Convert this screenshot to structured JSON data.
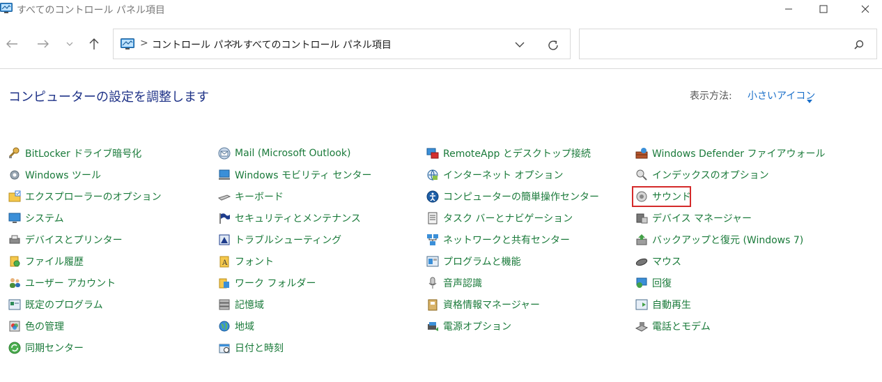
{
  "window": {
    "title": "すべてのコントロール パネル項目"
  },
  "address": {
    "crumbs": [
      "コントロール パネル",
      "すべてのコントロール パネル項目"
    ],
    "separator": ">"
  },
  "search": {
    "placeholder": ""
  },
  "header": {
    "title": "コンピューターの設定を調整します",
    "view_label": "表示方法:",
    "view_value": "小さいアイコン"
  },
  "items": [
    {
      "label": "BitLocker ドライブ暗号化",
      "icon": "bitlocker-icon"
    },
    {
      "label": "Windows ツール",
      "icon": "windows-tools-icon"
    },
    {
      "label": "エクスプローラーのオプション",
      "icon": "folder-options-icon"
    },
    {
      "label": "システム",
      "icon": "system-icon"
    },
    {
      "label": "デバイスとプリンター",
      "icon": "printer-icon"
    },
    {
      "label": "ファイル履歴",
      "icon": "file-history-icon"
    },
    {
      "label": "ユーザー アカウント",
      "icon": "user-accounts-icon"
    },
    {
      "label": "既定のプログラム",
      "icon": "default-programs-icon"
    },
    {
      "label": "色の管理",
      "icon": "color-management-icon"
    },
    {
      "label": "同期センター",
      "icon": "sync-center-icon"
    },
    {
      "label": "Mail (Microsoft Outlook)",
      "icon": "mail-icon"
    },
    {
      "label": "Windows モビリティ センター",
      "icon": "mobility-center-icon"
    },
    {
      "label": "キーボード",
      "icon": "keyboard-icon"
    },
    {
      "label": "セキュリティとメンテナンス",
      "icon": "security-flag-icon"
    },
    {
      "label": "トラブルシューティング",
      "icon": "troubleshooting-icon"
    },
    {
      "label": "フォント",
      "icon": "fonts-icon"
    },
    {
      "label": "ワーク フォルダー",
      "icon": "work-folders-icon"
    },
    {
      "label": "記憶域",
      "icon": "storage-spaces-icon"
    },
    {
      "label": "地域",
      "icon": "region-globe-icon"
    },
    {
      "label": "日付と時刻",
      "icon": "date-time-icon"
    },
    {
      "label": "RemoteApp とデスクトップ接続",
      "icon": "remoteapp-icon"
    },
    {
      "label": "インターネット オプション",
      "icon": "internet-options-icon"
    },
    {
      "label": "コンピューターの簡単操作センター",
      "icon": "ease-of-access-icon"
    },
    {
      "label": "タスク バーとナビゲーション",
      "icon": "taskbar-icon"
    },
    {
      "label": "ネットワークと共有センター",
      "icon": "network-icon"
    },
    {
      "label": "プログラムと機能",
      "icon": "programs-features-icon"
    },
    {
      "label": "音声認識",
      "icon": "microphone-icon"
    },
    {
      "label": "資格情報マネージャー",
      "icon": "credential-manager-icon"
    },
    {
      "label": "電源オプション",
      "icon": "power-options-icon"
    },
    {
      "label": "Windows Defender ファイアウォール",
      "icon": "firewall-icon"
    },
    {
      "label": "インデックスのオプション",
      "icon": "indexing-icon"
    },
    {
      "label": "サウンド",
      "icon": "sound-icon"
    },
    {
      "label": "デバイス マネージャー",
      "icon": "device-manager-icon"
    },
    {
      "label": "バックアップと復元 (Windows 7)",
      "icon": "backup-restore-icon"
    },
    {
      "label": "マウス",
      "icon": "mouse-icon"
    },
    {
      "label": "回復",
      "icon": "recovery-icon"
    },
    {
      "label": "自動再生",
      "icon": "autoplay-icon"
    },
    {
      "label": "電話とモデム",
      "icon": "phone-modem-icon"
    }
  ],
  "colors": {
    "link": "#1a7a3a",
    "title": "#1e3287",
    "accent": "#1a6fc9",
    "highlight": "#d42a2a"
  }
}
